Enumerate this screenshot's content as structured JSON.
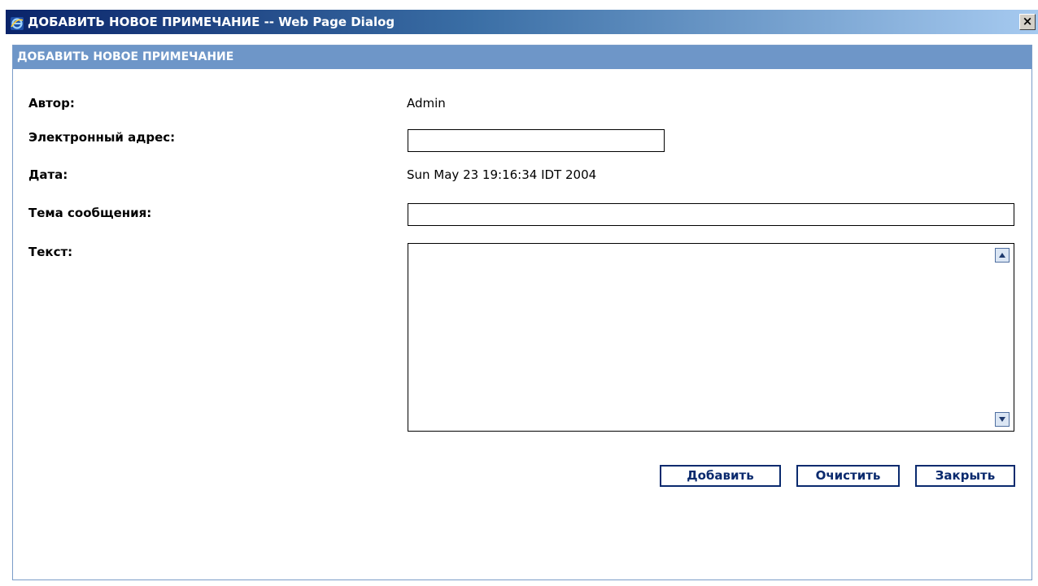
{
  "window": {
    "title": "ДОБАВИТЬ НОВОЕ ПРИМЕЧАНИЕ -- Web Page Dialog",
    "close_label": "×",
    "icon": "ie-icon"
  },
  "panel": {
    "header": "ДОБАВИТЬ НОВОЕ ПРИМЕЧАНИЕ"
  },
  "form": {
    "author_label": "Автор:",
    "author_value": "Admin",
    "email_label": "Электронный адрес:",
    "email_value": "",
    "date_label": "Дата:",
    "date_value": "Sun May 23 19:16:34 IDT 2004",
    "subject_label": "Тема сообщения:",
    "subject_value": "",
    "text_label": "Текст:",
    "text_value": ""
  },
  "buttons": {
    "add": "Добавить",
    "clear": "Очистить",
    "close": "Закрыть"
  },
  "colors": {
    "title_start": "#0a246a",
    "panel_header": "#6e96c8",
    "button_text": "#0a2a6e"
  }
}
